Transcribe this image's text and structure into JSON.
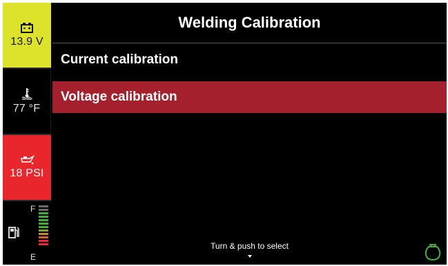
{
  "sidebar": {
    "voltage": {
      "icon": "battery-icon",
      "value": "13.9 V",
      "color": "#dde22a"
    },
    "temperature": {
      "icon": "coolant-temperature-icon",
      "value": "77 °F"
    },
    "oil_pressure": {
      "icon": "oil-pressure-icon",
      "value": "18 PSI",
      "color": "#e8262b"
    },
    "fuel": {
      "icon": "fuel-pump-icon",
      "full_label": "F",
      "empty_label": "E"
    }
  },
  "main": {
    "title": "Welding Calibration",
    "menu": [
      {
        "label": "Current calibration",
        "selected": false
      },
      {
        "label": "Voltage calibration",
        "selected": true,
        "highlight_color": "#a3202c"
      }
    ],
    "hint": "Turn & push to select",
    "status_icon": "engine-off-icon"
  }
}
